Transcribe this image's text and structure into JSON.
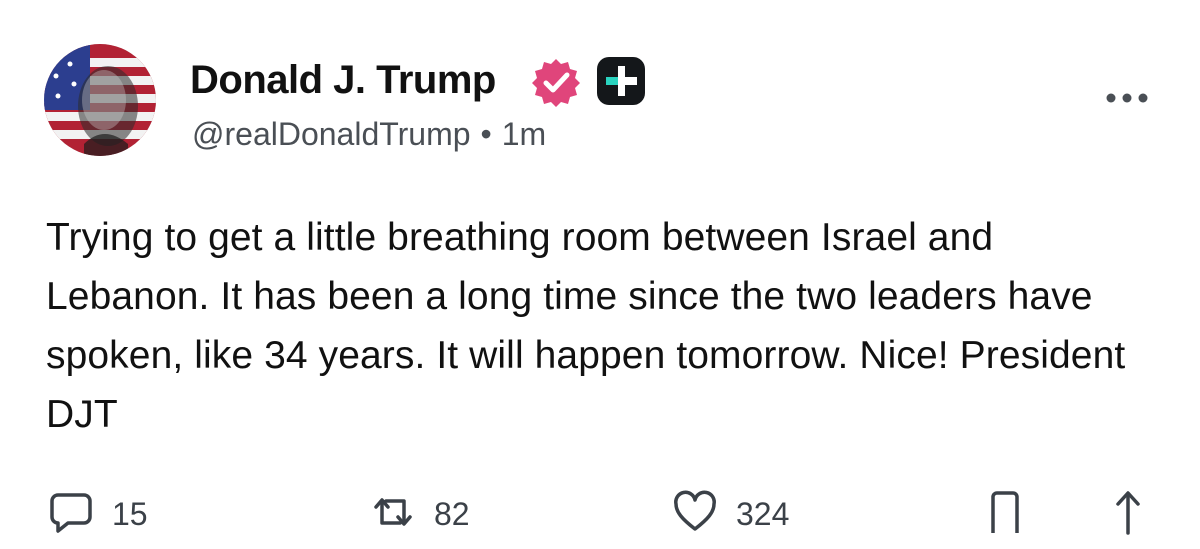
{
  "author": {
    "display_name": "Donald J. Trump",
    "handle": "@realDonaldTrump",
    "separator": "•",
    "time_ago": "1m",
    "verified": true,
    "verified_color": "#e0457b",
    "plus_badge_color": "#14171a",
    "plus_accent_color": "#2ad4c0"
  },
  "post": {
    "text": "Trying to get a little breathing room between Israel and Lebanon. It has been a long time since the two leaders have spoken, like 34 years. It will happen tomorrow. Nice! President DJT"
  },
  "actions": {
    "replies": "15",
    "reposts": "82",
    "likes": "324"
  },
  "icons": {
    "avatar": "avatar-flag-portrait",
    "verified": "verified-badge-icon",
    "plus": "plus-badge-icon",
    "more": "more-options-icon",
    "reply": "comment-icon",
    "repost": "repost-icon",
    "like": "heart-icon",
    "save": "bookmark-icon",
    "share": "share-icon"
  }
}
